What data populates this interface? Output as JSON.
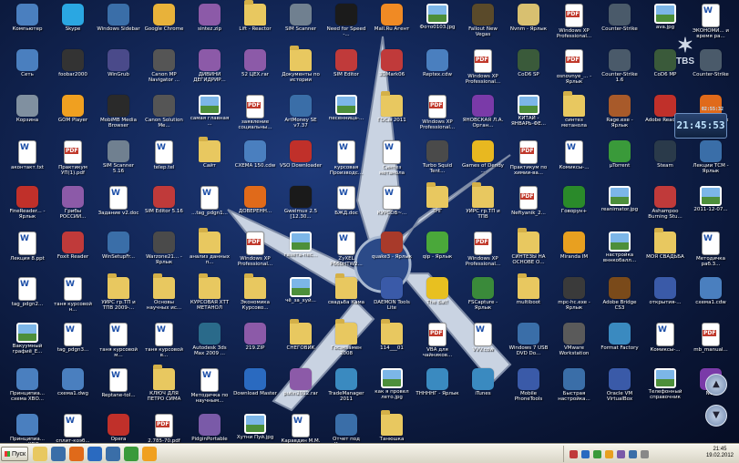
{
  "desktop": {
    "icons": [
      {
        "label": "Компьютер",
        "kind": "app",
        "color": "#4a7fbf"
      },
      {
        "label": "Skype",
        "kind": "app",
        "color": "#2aa7e2"
      },
      {
        "label": "Windows Sidebar",
        "kind": "app",
        "color": "#3a6ea8"
      },
      {
        "label": "Google Chrome",
        "kind": "app",
        "color": "#e8b23a"
      },
      {
        "label": "sintez.zip",
        "kind": "app",
        "color": "#8c5aa8"
      },
      {
        "label": "Lift - Reactor",
        "kind": "folder",
        "color": "#e8c860"
      },
      {
        "label": "SIM Scanner",
        "kind": "app",
        "color": "#708090"
      },
      {
        "label": "Need for Speed -...",
        "kind": "app",
        "color": "#1b1b1b"
      },
      {
        "label": "Mail.Ru Агент",
        "kind": "app",
        "color": "#f08a24"
      },
      {
        "label": "Фото0103.jpg",
        "kind": "img",
        "color": "#7cb6e8"
      },
      {
        "label": "Fallout New Vegas",
        "kind": "app",
        "color": "#5a4a2a"
      },
      {
        "label": "Nvnm - Ярлык",
        "kind": "app",
        "color": "#d8c070"
      },
      {
        "label": "Windows XP Professional...",
        "kind": "pdf",
        "color": "#ffffff"
      },
      {
        "label": "Counter-Strike",
        "kind": "app",
        "color": "#4a5a6a"
      },
      {
        "label": "ava.jpg",
        "kind": "img",
        "color": "#7cb6e8"
      },
      {
        "label": "ЭКОНОМИ... и время ра...",
        "kind": "doc",
        "color": "#ffffff"
      },
      {
        "label": "Сеть",
        "kind": "app",
        "color": "#4a7fbf"
      },
      {
        "label": "foobar2000",
        "kind": "app",
        "color": "#333333"
      },
      {
        "label": "WinGrub",
        "kind": "app",
        "color": "#4a4a8a"
      },
      {
        "label": "Canon MP Navigator ...",
        "kind": "app",
        "color": "#555555"
      },
      {
        "label": "ДИВИНИ ДЕГИДРИР...",
        "kind": "app",
        "color": "#8c5aa8"
      },
      {
        "label": "52 ЦЕХ.rar",
        "kind": "app",
        "color": "#8c5aa8"
      },
      {
        "label": "Документы по истории",
        "kind": "folder",
        "color": "#e8c860"
      },
      {
        "label": "SIM Editor",
        "kind": "app",
        "color": "#c03a3a"
      },
      {
        "label": "3DMark06",
        "kind": "app",
        "color": "#c03a3a"
      },
      {
        "label": "Reptex.cdw",
        "kind": "app",
        "color": "#4a7fbf"
      },
      {
        "label": "Windows XP Professional...",
        "kind": "pdf",
        "color": "#ffffff"
      },
      {
        "label": "CoD6 SP",
        "kind": "app",
        "color": "#3a5a3a"
      },
      {
        "label": "osnovnye_... - Ярлык",
        "kind": "pdf",
        "color": "#ffffff"
      },
      {
        "label": "Counter-Strike 1.6",
        "kind": "app",
        "color": "#4a5a6a"
      },
      {
        "label": "CoD6 MP",
        "kind": "app",
        "color": "#3a5a3a"
      },
      {
        "label": "Counter-Strike",
        "kind": "app",
        "color": "#4a5a6a"
      },
      {
        "label": "Корзина",
        "kind": "app",
        "color": "#8090a0"
      },
      {
        "label": "GOM Player",
        "kind": "app",
        "color": "#f0a020"
      },
      {
        "label": "MobiMB Media Browser",
        "kind": "app",
        "color": "#2a2a2a"
      },
      {
        "label": "Canon Solution Me...",
        "kind": "app",
        "color": "#555555"
      },
      {
        "label": "самая главная ...",
        "kind": "img",
        "color": "#7cb6e8"
      },
      {
        "label": "заявление социальны...",
        "kind": "pdf",
        "color": "#ffffff"
      },
      {
        "label": "ArtMoney SE v7.37",
        "kind": "app",
        "color": "#3a6ea8"
      },
      {
        "label": "песенница-...",
        "kind": "img",
        "color": "#7cb6e8"
      },
      {
        "label": "ГОСы 2011",
        "kind": "folder",
        "color": "#e8c860"
      },
      {
        "label": "Windows XP Professional...",
        "kind": "pdf",
        "color": "#ffffff"
      },
      {
        "label": "ЯНОВСКАЯ Л.А. Орган...",
        "kind": "app",
        "color": "#7a3aa8"
      },
      {
        "label": "КИТАЙ - ЯНВАРЬ-ФЕ...",
        "kind": "img",
        "color": "#7cb6e8"
      },
      {
        "label": "синтез метанола",
        "kind": "folder",
        "color": "#e8c860"
      },
      {
        "label": "Rage.exe - Ярлык",
        "kind": "app",
        "color": "#a85a2a"
      },
      {
        "label": "Adobe Reader 9",
        "kind": "app",
        "color": "#c0302a"
      },
      {
        "label": "Mozilla Firefox",
        "kind": "app",
        "color": "#e06a1a"
      },
      {
        "label": "аконтакт.txt",
        "kind": "doc",
        "color": "#ffffff"
      },
      {
        "label": "Практикум УП(1).pdf",
        "kind": "pdf",
        "color": "#ffffff"
      },
      {
        "label": "SIM Scanner 5.16",
        "kind": "app",
        "color": "#708090"
      },
      {
        "label": "telep.tel",
        "kind": "doc",
        "color": "#ffffff"
      },
      {
        "label": "Сайт",
        "kind": "folder",
        "color": "#e8c860"
      },
      {
        "label": "СХЕМА 150.cdw",
        "kind": "app",
        "color": "#4a7fbf"
      },
      {
        "label": "VSO Downloader",
        "kind": "app",
        "color": "#c0302a"
      },
      {
        "label": "курсовая Производс...",
        "kind": "doc",
        "color": "#ffffff"
      },
      {
        "label": "Синтез метанола",
        "kind": "doc",
        "color": "#ffffff"
      },
      {
        "label": "Turbo Squid Tent...",
        "kind": "app",
        "color": "#4a4a4a"
      },
      {
        "label": "Games of Dendy ...",
        "kind": "app",
        "color": "#e8b820"
      },
      {
        "label": "Практикум по химии-ва...",
        "kind": "pdf",
        "color": "#ffffff"
      },
      {
        "label": "Комиксы-...",
        "kind": "doc",
        "color": "#ffffff"
      },
      {
        "label": "µTorrent",
        "kind": "app",
        "color": "#3a9a3a"
      },
      {
        "label": "Steam",
        "kind": "app",
        "color": "#2a3a4a"
      },
      {
        "label": "Лекции ТСМ - Ярлык",
        "kind": "app",
        "color": "#3a6ea8"
      },
      {
        "label": "FineReader... - Ярлык",
        "kind": "app",
        "color": "#c0302a"
      },
      {
        "label": "Грибы РОССИИ...",
        "kind": "app",
        "color": "#8c5aa8"
      },
      {
        "label": "Задание v2.doc",
        "kind": "doc",
        "color": "#ffffff"
      },
      {
        "label": "SIM Editor 5.16",
        "kind": "app",
        "color": "#c03a3a"
      },
      {
        "label": "...tag_pdgn1...",
        "kind": "doc",
        "color": "#ffffff"
      },
      {
        "label": "ДОВЕРЕНН...",
        "kind": "app",
        "color": "#e06a1a"
      },
      {
        "label": "Gwelmux 2.5 [12.30...",
        "kind": "app",
        "color": "#1a1a1a"
      },
      {
        "label": "БЖД.doc",
        "kind": "doc",
        "color": "#ffffff"
      },
      {
        "label": "КУРСОВ~...",
        "kind": "doc",
        "color": "#ffffff"
      },
      {
        "label": "ТНГ",
        "kind": "folder",
        "color": "#e8c860"
      },
      {
        "label": "УИРС гр.ТП и ТПВ",
        "kind": "folder",
        "color": "#e8c860"
      },
      {
        "label": "Neftyanik_2...",
        "kind": "pdf",
        "color": "#ffffff"
      },
      {
        "label": "Говорун+",
        "kind": "app",
        "color": "#2a8a2a"
      },
      {
        "label": "reanimator.jpg",
        "kind": "img",
        "color": "#7cb6e8"
      },
      {
        "label": "Ashampoo Burning Stu...",
        "kind": "app",
        "color": "#c03a3a"
      },
      {
        "label": "2011-12-07...",
        "kind": "img",
        "color": "#7cb6e8"
      },
      {
        "label": "Лекция 8.ppt",
        "kind": "doc",
        "color": "#ffffff"
      },
      {
        "label": "Foxit Reader",
        "kind": "app",
        "color": "#c03a3a"
      },
      {
        "label": "WinSetupFr...",
        "kind": "app",
        "color": "#3a6ea8"
      },
      {
        "label": "Warzone21... - Ярлык",
        "kind": "app",
        "color": "#4a4a4a"
      },
      {
        "label": "анализ данных п...",
        "kind": "folder",
        "color": "#e8c860"
      },
      {
        "label": "Windows XP Professional...",
        "kind": "pdf",
        "color": "#ffffff"
      },
      {
        "label": "газета-пес...",
        "kind": "img",
        "color": "#7cb6e8"
      },
      {
        "label": "ZyXEL P660HTW2...",
        "kind": "doc",
        "color": "#ffffff"
      },
      {
        "label": "quake3 - Ярлык",
        "kind": "app",
        "color": "#a83a2a"
      },
      {
        "label": "qip - Ярлык",
        "kind": "app",
        "color": "#4aa83a"
      },
      {
        "label": "Windows XP Professional...",
        "kind": "pdf",
        "color": "#ffffff"
      },
      {
        "label": "СИНТЕЗЫ НА ОСНОВЕ О...",
        "kind": "folder",
        "color": "#e8c860"
      },
      {
        "label": "Miranda IM",
        "kind": "app",
        "color": "#e8a020"
      },
      {
        "label": "настройка вннкобалл...",
        "kind": "img",
        "color": "#7cb6e8"
      },
      {
        "label": "МОЯ СВАДЬБА",
        "kind": "folder",
        "color": "#e8c860"
      },
      {
        "label": "Методичка раб.3...",
        "kind": "doc",
        "color": "#ffffff"
      },
      {
        "label": "tag_pdgn2...",
        "kind": "doc",
        "color": "#ffffff"
      },
      {
        "label": "таня курсовой н...",
        "kind": "doc",
        "color": "#ffffff"
      },
      {
        "label": "УИРС гр.ТП и ТПВ 2009-...",
        "kind": "folder",
        "color": "#e8c860"
      },
      {
        "label": "Основы научных ис...",
        "kind": "folder",
        "color": "#e8c860"
      },
      {
        "label": "КУРСОВАЯ ХТТ МЕТАНОЛ",
        "kind": "folder",
        "color": "#e8c860"
      },
      {
        "label": "Экономика Курсово...",
        "kind": "folder",
        "color": "#e8c860"
      },
      {
        "label": "чё_за_хуй...",
        "kind": "img",
        "color": "#7cb6e8"
      },
      {
        "label": "свадьба Кама",
        "kind": "folder",
        "color": "#e8c860"
      },
      {
        "label": "DAEMON Tools Lite",
        "kind": "app",
        "color": "#3a5aa8"
      },
      {
        "label": "The Bat!",
        "kind": "app",
        "color": "#e8c020"
      },
      {
        "label": "FSCapture - Ярлык",
        "kind": "app",
        "color": "#3a8a3a"
      },
      {
        "label": "multiboot",
        "kind": "folder",
        "color": "#e8c860"
      },
      {
        "label": "mpc-hc.exe - Ярлык",
        "kind": "app",
        "color": "#3a3a3a"
      },
      {
        "label": "Adobe Bridge CS3",
        "kind": "app",
        "color": "#7a4a1a"
      },
      {
        "label": "открытия-...",
        "kind": "app",
        "color": "#3a5aa8"
      },
      {
        "label": "схема1.cdw",
        "kind": "app",
        "color": "#4a7fbf"
      },
      {
        "label": "Вакуумный графиё_E...",
        "kind": "img",
        "color": "#7cb6e8"
      },
      {
        "label": "tag_pdgn3...",
        "kind": "doc",
        "color": "#ffffff"
      },
      {
        "label": "таня курсовой м...",
        "kind": "doc",
        "color": "#ffffff"
      },
      {
        "label": "таня курсовой в...",
        "kind": "doc",
        "color": "#ffffff"
      },
      {
        "label": "Autodesk 3ds Max 2009 ...",
        "kind": "app",
        "color": "#2a6a8a"
      },
      {
        "label": "219.ZIP",
        "kind": "app",
        "color": "#8c5aa8"
      },
      {
        "label": "СНЕГОВИК",
        "kind": "folder",
        "color": "#e8c860"
      },
      {
        "label": "Госэкзамен 2008",
        "kind": "folder",
        "color": "#e8c860"
      },
      {
        "label": "114___01",
        "kind": "folder",
        "color": "#e8c860"
      },
      {
        "label": "VBA для чайников...",
        "kind": "pdf",
        "color": "#ffffff"
      },
      {
        "label": "VVV.cdw",
        "kind": "doc",
        "color": "#ffffff"
      },
      {
        "label": "Windows 7 USB DVD Do...",
        "kind": "app",
        "color": "#3a6ea8"
      },
      {
        "label": "VMware Workstation",
        "kind": "app",
        "color": "#5a5a5a"
      },
      {
        "label": "Format Factory",
        "kind": "app",
        "color": "#3a8ac0"
      },
      {
        "label": "Комиксы-...",
        "kind": "doc",
        "color": "#ffffff"
      },
      {
        "label": "mb_manual...",
        "kind": "pdf",
        "color": "#ffffff"
      },
      {
        "label": "Принципиа... схема ХВО...",
        "kind": "app",
        "color": "#4a7fbf"
      },
      {
        "label": "схема1.dwg",
        "kind": "app",
        "color": "#4a7fbf"
      },
      {
        "label": "Reptane-tol...",
        "kind": "doc",
        "color": "#ffffff"
      },
      {
        "label": "КЛЮЧ ДЛЯ ПЕТРО СИМА",
        "kind": "folder",
        "color": "#e8c860"
      },
      {
        "label": "Методичка по научным...",
        "kind": "doc",
        "color": "#ffffff"
      },
      {
        "label": "Download Master",
        "kind": "app",
        "color": "#2a6ac0"
      },
      {
        "label": "putin2012.rar",
        "kind": "app",
        "color": "#8c5aa8"
      },
      {
        "label": "TradeManager 2011",
        "kind": "app",
        "color": "#3a8ac0"
      },
      {
        "label": "как я провел лето.jpg",
        "kind": "img",
        "color": "#7cb6e8"
      },
      {
        "label": "ТННННГ - Ярлык",
        "kind": "app",
        "color": "#3a8ac0"
      },
      {
        "label": "iTunes",
        "kind": "app",
        "color": "#3a8ac0"
      },
      {
        "label": "Mobile PhoneTools",
        "kind": "app",
        "color": "#3a5aa8"
      },
      {
        "label": "Быстрая настройка...",
        "kind": "app",
        "color": "#3a6ea8"
      },
      {
        "label": "Oracle VM VirtualBox",
        "kind": "app",
        "color": "#3a5aa8"
      },
      {
        "label": "Телефонный справочник",
        "kind": "img",
        "color": "#7cb6e8"
      },
      {
        "label": "Nvu",
        "kind": "app",
        "color": "#7a3aa8"
      },
      {
        "label": "Принципиа... схема ХВО...",
        "kind": "app",
        "color": "#4a7fbf"
      },
      {
        "label": "сплит-коэб...",
        "kind": "doc",
        "color": "#ffffff"
      },
      {
        "label": "Opera",
        "kind": "app",
        "color": "#c0302a"
      },
      {
        "label": "2.785-70.pdf",
        "kind": "pdf",
        "color": "#ffffff"
      },
      {
        "label": "PidginPortable",
        "kind": "app",
        "color": "#7a5aa8"
      },
      {
        "label": "Хутни Пуй.jpg",
        "kind": "img",
        "color": "#7cb6e8"
      },
      {
        "label": "Каравдин M.M. Техно...",
        "kind": "doc",
        "color": "#ffffff"
      },
      {
        "label": "Отчет под Комикс...",
        "kind": "app",
        "color": "#3a6ea8"
      },
      {
        "label": "Танюшка",
        "kind": "folder",
        "color": "#e8c860"
      }
    ]
  },
  "gadget": {
    "time": "21:45:53",
    "subtitle": "02:55:32"
  },
  "logo": {
    "text": "TBS"
  },
  "taskbar": {
    "start_label": "Пуск",
    "quick_launch_colors": [
      "#e8c860",
      "#3a6ea8",
      "#e06a1a",
      "#2a6ac0",
      "#3a6ea8",
      "#3a9a3a",
      "#f0a020"
    ],
    "tray_colors": [
      "#c03a3a",
      "#2a6ac0",
      "#3a9a3a",
      "#e8a020",
      "#7a5aa8",
      "#3a6ea8",
      "#888888"
    ],
    "clock_time": "21:45",
    "clock_date": "19.02.2012"
  }
}
